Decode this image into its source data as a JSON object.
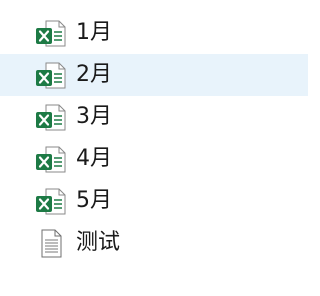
{
  "files": [
    {
      "name": "1月",
      "icon": "excel-file-icon",
      "selected": false
    },
    {
      "name": "2月",
      "icon": "excel-file-icon",
      "selected": true
    },
    {
      "name": "3月",
      "icon": "excel-file-icon",
      "selected": false
    },
    {
      "name": "4月",
      "icon": "excel-file-icon",
      "selected": false
    },
    {
      "name": "5月",
      "icon": "excel-file-icon",
      "selected": false
    },
    {
      "name": "测试",
      "icon": "text-file-icon",
      "selected": false
    }
  ],
  "colors": {
    "excel_green": "#1d7a45",
    "selection": "#e8f3fb",
    "text": "#1a1a1a"
  }
}
